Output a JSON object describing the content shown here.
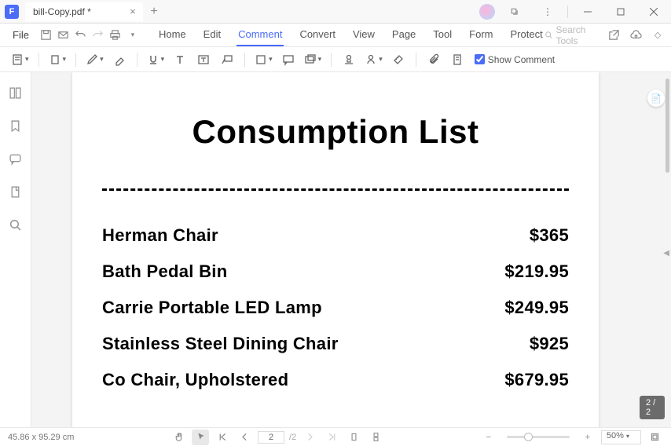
{
  "titlebar": {
    "tab_title": "bill-Copy.pdf *"
  },
  "menubar": {
    "file": "File",
    "tabs": [
      "Home",
      "Edit",
      "Comment",
      "Convert",
      "View",
      "Page",
      "Tool",
      "Form",
      "Protect"
    ],
    "active": "Comment",
    "search_placeholder": "Search Tools"
  },
  "toolbar": {
    "show_comment": "Show Comment"
  },
  "document": {
    "title": "Consumption List",
    "items": [
      {
        "name": "Herman Chair",
        "price": "$365"
      },
      {
        "name": "Bath Pedal Bin",
        "price": "$219.95"
      },
      {
        "name": "Carrie Portable LED Lamp",
        "price": "$249.95"
      },
      {
        "name": "Stainless Steel Dining Chair",
        "price": "$925"
      },
      {
        "name": "Co Chair, Upholstered",
        "price": "$679.95"
      }
    ]
  },
  "page_badge": "2 / 2",
  "statusbar": {
    "dimensions": "45.86 x 95.29 cm",
    "page_current": "2",
    "page_total": "/2",
    "zoom": "50%"
  }
}
